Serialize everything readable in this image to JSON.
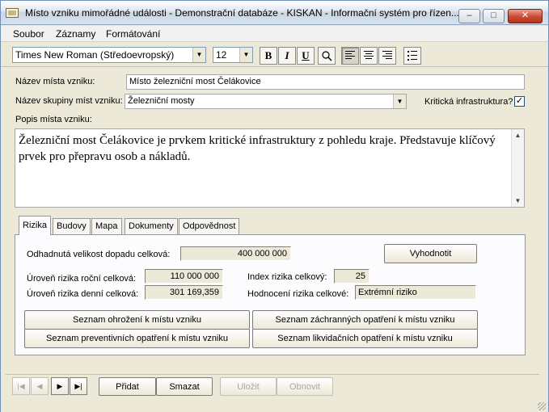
{
  "window": {
    "title": "Místo vzniku mimořádné události - Demonstrační databáze - KISKAN - Informační systém pro řízen...",
    "controls": {
      "minimize": "–",
      "maximize": "□",
      "close": "✕"
    }
  },
  "menu": [
    "Soubor",
    "Záznamy",
    "Formátování"
  ],
  "toolbar": {
    "font_name": "Times New Roman (Středoevropský)",
    "font_size": "12",
    "bold": "B",
    "italic": "I",
    "underline": "U",
    "icons": {
      "highlight": "highlight-icon",
      "align_left": "align-left-icon",
      "align_center": "align-center-icon",
      "align_right": "align-right-icon",
      "bullets": "bullet-list-icon"
    }
  },
  "form": {
    "name_label": "Název místa vzniku:",
    "name_value": "Místo železniční most Čelákovice",
    "group_label": "Název skupiny míst vzniku:",
    "group_value": "Železniční mosty",
    "critical_label": "Kritická infrastruktura?",
    "critical_checked": true,
    "critical_mark": "✓",
    "desc_label": "Popis místa vzniku:",
    "desc_value": "Železniční most Čelákovice je prvkem kritické infrastruktury z pohledu kraje. Představuje klíčový prvek pro přepravu osob a nákladů."
  },
  "tabs": [
    "Rizika",
    "Budovy",
    "Mapa",
    "Dokumenty",
    "Odpovědnost"
  ],
  "active_tab": "Rizika",
  "risk": {
    "impact_label": "Odhadnutá velikost dopadu celková:",
    "impact_value": "400 000 000",
    "evaluate_button": "Vyhodnotit",
    "annual_label": "Úroveň rizika roční celková:",
    "annual_value": "110 000 000",
    "index_label": "Index rizika celkový:",
    "index_value": "25",
    "daily_label": "Úroveň rizika denní celková:",
    "daily_value": "301 169,359",
    "rating_label": "Hodnocení rizika celkové:",
    "rating_value": "Extrémní riziko",
    "btn_threats": "Seznam ohrožení k místu vzniku",
    "btn_rescue": "Seznam záchranných opatření k místu vzniku",
    "btn_preventive": "Seznam preventivních opatření k místu vzniku",
    "btn_liquidation": "Seznam likvidačních opatření k místu vzniku"
  },
  "nav": {
    "first": "first-record-icon",
    "prev": "prev-record-icon",
    "next": "next-record-icon",
    "last": "last-record-icon",
    "add": "Přidat",
    "delete": "Smazat",
    "save": "Uložit",
    "refresh": "Obnovit"
  }
}
